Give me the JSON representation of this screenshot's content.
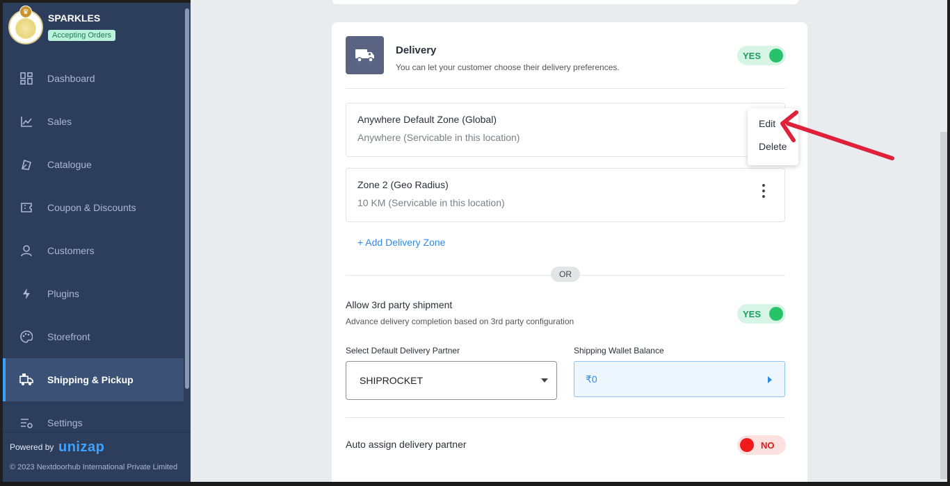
{
  "brand": {
    "name": "SPARKLES",
    "status": "Accepting Orders"
  },
  "sidebar": {
    "items": [
      {
        "label": "Dashboard",
        "icon": "dashboard-icon"
      },
      {
        "label": "Sales",
        "icon": "chart-line-icon"
      },
      {
        "label": "Catalogue",
        "icon": "tag-icon"
      },
      {
        "label": "Coupon & Discounts",
        "icon": "ticket-icon"
      },
      {
        "label": "Customers",
        "icon": "user-icon"
      },
      {
        "label": "Plugins",
        "icon": "bolt-icon"
      },
      {
        "label": "Storefront",
        "icon": "palette-icon"
      },
      {
        "label": "Shipping & Pickup",
        "icon": "delivery-icon",
        "active": true
      },
      {
        "label": "Settings",
        "icon": "settings-icon"
      }
    ],
    "powered_by": "Powered by",
    "logo_text": "unizap",
    "copyright": "© 2023 Nextdoorhub International Private Limited"
  },
  "delivery": {
    "title": "Delivery",
    "subtitle": "You can let your customer choose their delivery preferences.",
    "toggle": "YES",
    "zones": [
      {
        "title": "Anywhere Default Zone (Global)",
        "sub": "Anywhere (Servicable in this location)"
      },
      {
        "title": "Zone 2 (Geo Radius)",
        "sub": "10 KM (Servicable in this location)"
      }
    ],
    "add_zone": "+ Add Delivery Zone",
    "or": "OR"
  },
  "third_party": {
    "title": "Allow 3rd party shipment",
    "subtitle": "Advance delivery completion based on 3rd party configuration",
    "toggle": "YES",
    "partner_label": "Select Default Delivery Partner",
    "partner_value": "SHIPROCKET",
    "wallet_label": "Shipping Wallet Balance",
    "wallet_value": "₹0"
  },
  "auto_assign": {
    "title": "Auto assign delivery partner",
    "toggle": "NO"
  },
  "menu": {
    "edit": "Edit",
    "delete": "Delete"
  },
  "colors": {
    "sidebar": "#2c3e5c",
    "accent": "#3aa0ff",
    "yes": "#27c26a",
    "no": "#f01a1a",
    "annotation_arrow": "#e0213a"
  }
}
